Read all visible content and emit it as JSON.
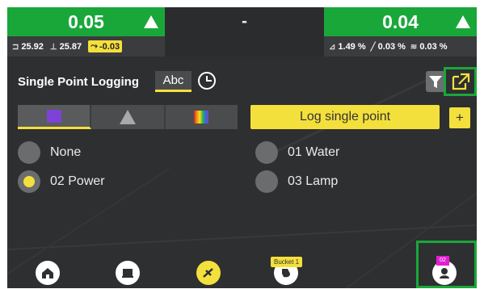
{
  "metrics": {
    "left": {
      "value": "0.05",
      "reading1": "25.92",
      "reading2": "25.87",
      "offset": "-0.03"
    },
    "center": {
      "value": "-"
    },
    "right": {
      "value": "0.04",
      "percent1": "1.49 %",
      "percent2": "0.03 %",
      "percent3": "0.03 %"
    }
  },
  "panel": {
    "title": "Single Point Logging",
    "abc_label": "Abc",
    "log_button": "Log single point",
    "plus_label": "+"
  },
  "options": [
    {
      "label": "None",
      "selected": false
    },
    {
      "label": "01 Water",
      "selected": false
    },
    {
      "label": "02 Power",
      "selected": true
    },
    {
      "label": "03 Lamp",
      "selected": false
    }
  ],
  "bottom_nav": {
    "bucket_label": "Bucket 1",
    "badge_text": "02",
    "icons": [
      "home-icon",
      "machine-icon",
      "measure-icon",
      "bucket-icon",
      "user-icon"
    ]
  },
  "colors": {
    "accent_green": "#1aa73a",
    "accent_yellow": "#f4e03c",
    "badge_magenta": "#e21fd1",
    "selected_color": "#7d43d6"
  }
}
